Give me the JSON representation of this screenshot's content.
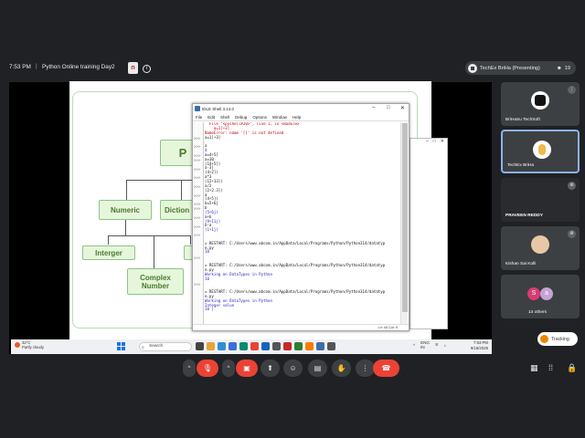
{
  "meeting": {
    "time": "7:53 PM",
    "separator": "|",
    "title": "Python Online training Day2",
    "badge": "n",
    "info": "i",
    "presenting": "TechEx BriHa (Presenting)",
    "people_count": "19"
  },
  "slide": {
    "root": "P",
    "numeric": "Numeric",
    "dictionary": "Diction",
    "integer": "Interger",
    "complex": "Complex Number"
  },
  "idle": {
    "title": "IDLE Shell 3.14.0",
    "menu": [
      "File",
      "Edit",
      "Shell",
      "Debug",
      "Options",
      "Window",
      "Help"
    ],
    "status": "Ln: 44   Col: 0",
    "lines": [
      {
        "p": "",
        "t": "  File \"<pyshell#20>\", line 1, in <module>",
        "c": "c-red"
      },
      {
        "p": "",
        "t": "    a=1[+3]",
        "c": "c-red"
      },
      {
        "p": "",
        "t": "NameError: name '[]' is not defined",
        "c": "c-red"
      },
      {
        "p": ">>>",
        "t": "a=1[+3]",
        "c": "c-black"
      },
      {
        "p": "",
        "t": "",
        "c": "c-black"
      },
      {
        "p": ">>>",
        "t": "a",
        "c": "c-black"
      },
      {
        "p": "",
        "t": "4",
        "c": "c-out"
      },
      {
        "p": ">>>",
        "t": "a=4+5]",
        "c": "c-black"
      },
      {
        "p": ">>>",
        "t": "a=10",
        "c": "c-black"
      },
      {
        "p": "",
        "t": "(14+5])",
        "c": "c-black"
      },
      {
        "p": ">>>",
        "t": "a-3]",
        "c": "c-black"
      },
      {
        "p": "",
        "t": "(4+2])",
        "c": "c-black"
      },
      {
        "p": ">>>",
        "t": "a*3",
        "c": "c-black"
      },
      {
        "p": "",
        "t": "(12+13])",
        "c": "c-black"
      },
      {
        "p": ">>>",
        "t": "a/2",
        "c": "c-black"
      },
      {
        "p": "",
        "t": "(2+2.3])",
        "c": "c-black"
      },
      {
        "p": ">>>",
        "t": "a",
        "c": "c-black"
      },
      {
        "p": "",
        "t": "(4+5])",
        "c": "c-black"
      },
      {
        "p": ">>>",
        "t": "b=5+6j",
        "c": "c-black"
      },
      {
        "p": ">>>",
        "t": "b",
        "c": "c-black"
      },
      {
        "p": "",
        "t": "(5+6j)",
        "c": "c-out"
      },
      {
        "p": ">>>",
        "t": "a+b",
        "c": "c-black"
      },
      {
        "p": "",
        "t": "(9+11j)",
        "c": "c-out"
      },
      {
        "p": ">>>",
        "t": "b-a",
        "c": "c-black"
      },
      {
        "p": "",
        "t": "(1+1j)",
        "c": "c-out"
      },
      {
        "p": ">>>",
        "t": "",
        "c": "c-black"
      },
      {
        "p": "",
        "t": "",
        "c": "c-black"
      },
      {
        "p": "",
        "t": "= RESTART: C:/Users/www.abcom.in/AppData/Local/Programs/Python/Python314/datatyp",
        "c": "c-black"
      },
      {
        "p": "",
        "t": "e.py",
        "c": "c-black"
      },
      {
        "p": "",
        "t": "10",
        "c": "c-out"
      },
      {
        "p": ">>>",
        "t": "",
        "c": "c-black"
      },
      {
        "p": "",
        "t": "",
        "c": "c-black"
      },
      {
        "p": "",
        "t": "= RESTART: C:/Users/www.abcom.in/AppData/Local/Programs/Python/Python314/datatyp",
        "c": "c-black"
      },
      {
        "p": "",
        "t": "e.py",
        "c": "c-black"
      },
      {
        "p": "",
        "t": "Working on DataTypes in Python",
        "c": "c-out"
      },
      {
        "p": "",
        "t": "10",
        "c": "c-out"
      },
      {
        "p": ">>>",
        "t": "",
        "c": "c-black"
      },
      {
        "p": "",
        "t": "",
        "c": "c-black"
      },
      {
        "p": "",
        "t": "= RESTART: C:/Users/www.abcom.in/AppData/Local/Programs/Python/Python314/datatyp",
        "c": "c-black"
      },
      {
        "p": "",
        "t": "e.py",
        "c": "c-black"
      },
      {
        "p": "",
        "t": "Working on DataTypes in Python",
        "c": "c-out"
      },
      {
        "p": "",
        "t": "Integer value",
        "c": "c-out"
      },
      {
        "p": "",
        "t": "10 ]",
        "c": "c-out"
      }
    ]
  },
  "taskbar": {
    "temp": "32°C",
    "weather": "Partly cloudy",
    "search": "Search",
    "lang1": "ENG",
    "lang2": "IN",
    "clock_time": "7:53 PM",
    "clock_date": "9/18/2025"
  },
  "participants": [
    {
      "name": "BriHaSu TechSoft"
    },
    {
      "name": "TechEx BriHa"
    },
    {
      "name": "PRAVEEN REDDY"
    },
    {
      "name": "Kishan Sai Kolli"
    },
    {
      "name": "14 others",
      "a1": "S",
      "a2": "a"
    }
  ],
  "tracking": "Tracking",
  "colors": {
    "accent": "#8ab4f8",
    "danger": "#ea4335",
    "tile": "#3c4043",
    "slide_green": "#e6f6da"
  }
}
